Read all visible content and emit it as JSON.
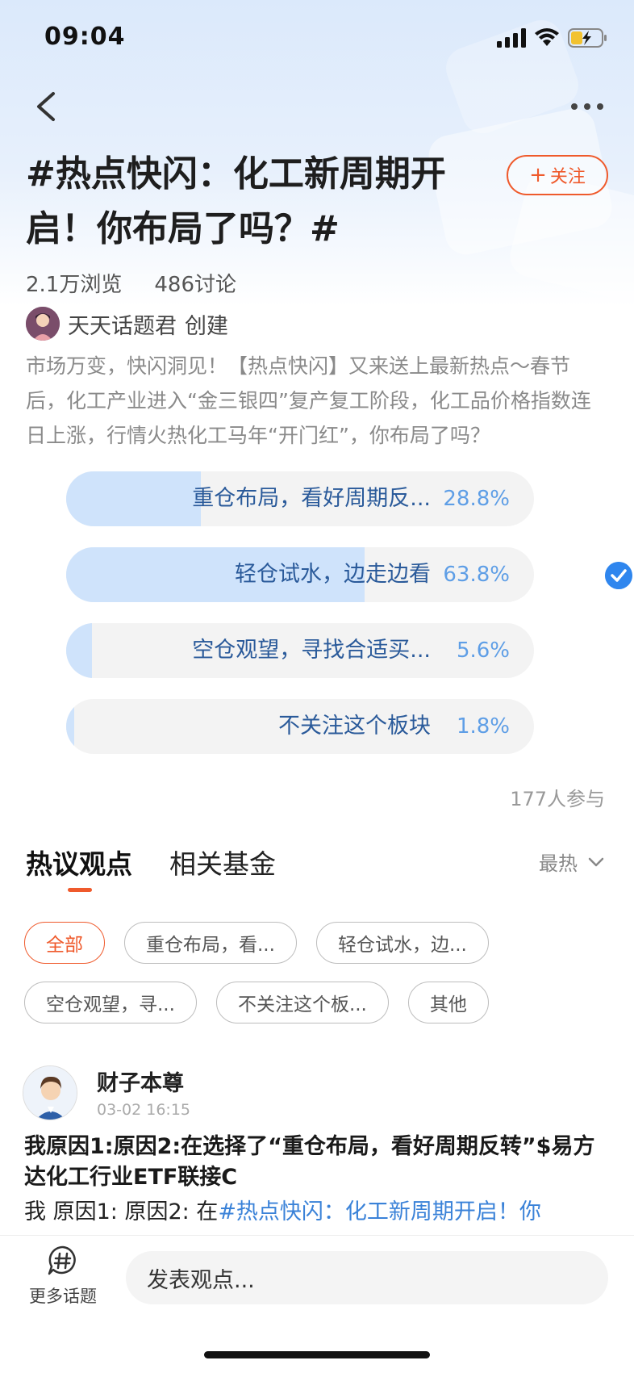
{
  "status_bar": {
    "time": "09:04"
  },
  "topic": {
    "title": "#热点快闪：化工新周期开启！你布局了吗？#",
    "follow_label": "关注",
    "views": "2.1万浏览",
    "discussions": "486讨论",
    "creator_name": "天天话题君",
    "creator_suffix": "创建",
    "description": "市场万变，快闪洞见！【热点快闪】又来送上最新热点～春节后，化工产业进入“金三银四”复产复工阶段，化工品价格指数连日上涨，行情火热化工马年“开门红”，你布局了吗？"
  },
  "poll": {
    "options": [
      {
        "label": "重仓布局，看好周期反...",
        "percent": "28.8%",
        "value": 0.288
      },
      {
        "label": "轻仓试水，边走边看",
        "percent": "63.8%",
        "value": 0.638,
        "selected": true
      },
      {
        "label": "空仓观望，寻找合适买...",
        "percent": "5.6%",
        "value": 0.056
      },
      {
        "label": "不关注这个板块",
        "percent": "1.8%",
        "value": 0.018
      }
    ],
    "participants": "177人参与",
    "accent_color": "#2f86ee"
  },
  "tabs": [
    {
      "label": "热议观点",
      "active": true
    },
    {
      "label": "相关基金",
      "active": false
    }
  ],
  "sort": {
    "label": "最热"
  },
  "filters": [
    {
      "label": "全部",
      "active": true
    },
    {
      "label": "重仓布局，看...",
      "active": false
    },
    {
      "label": "轻仓试水，边...",
      "active": false
    },
    {
      "label": "空仓观望，寻...",
      "active": false
    },
    {
      "label": "不关注这个板...",
      "active": false
    },
    {
      "label": "其他",
      "active": false
    }
  ],
  "post": {
    "author": "财子本尊",
    "time": "03-02 16:15",
    "title": "我原因1:原因2:在选择了“重仓布局，看好周期反转”$易方达化工行业ETF联接C",
    "body_prefix": "我 原因1: 原因2: 在",
    "body_link": "#热点快闪：化工新周期开启！你"
  },
  "bottom": {
    "more_topics_label": "更多话题",
    "input_placeholder": "发表观点..."
  },
  "colors": {
    "brand_orange": "#ef5a2c",
    "poll_fill": "#cfe3fb",
    "link_blue": "#3a82d8"
  }
}
